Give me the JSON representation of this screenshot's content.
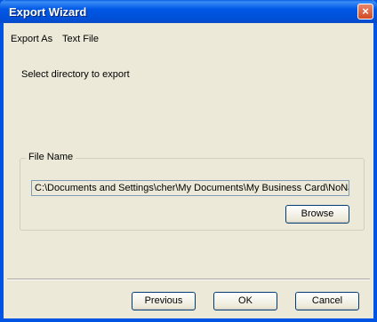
{
  "window": {
    "title": "Export Wizard",
    "close_symbol": "×"
  },
  "header": {
    "export_as_label": "Export As",
    "export_as_value": "Text File"
  },
  "instruction": "Select directory to export",
  "file_group": {
    "legend": "File Name",
    "path": "C:\\Documents and Settings\\cher\\My Documents\\My Business Card\\NoName.txt",
    "browse_label": "Browse"
  },
  "footer": {
    "previous_label": "Previous",
    "ok_label": "OK",
    "cancel_label": "Cancel"
  },
  "colors": {
    "titlebar": "#0054e3",
    "close_button": "#d24a24",
    "dialog_bg": "#ece9d8"
  }
}
